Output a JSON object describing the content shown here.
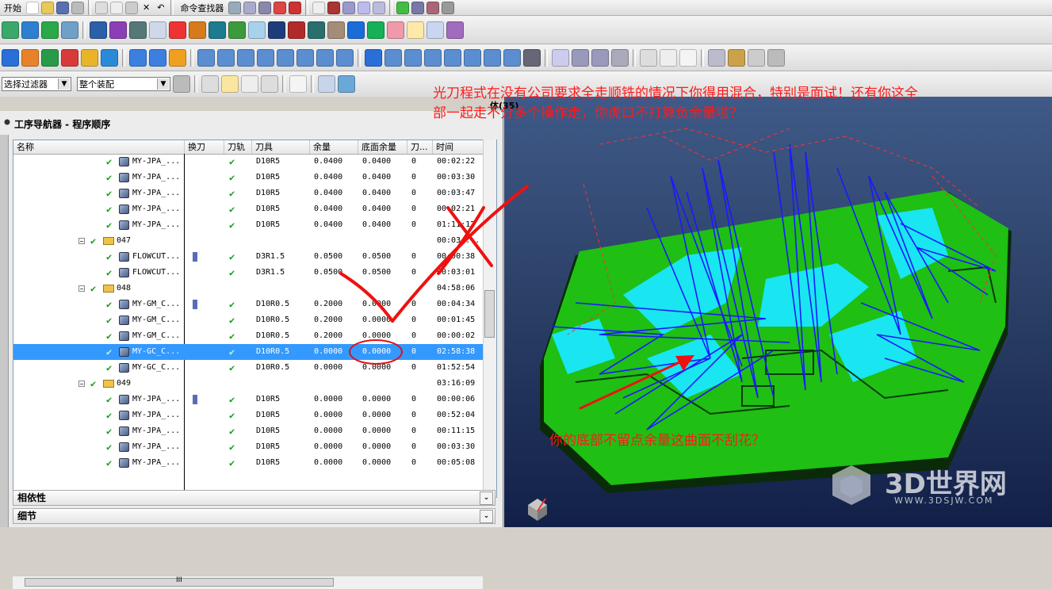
{
  "toolbar_row1": {
    "start_label": "开始",
    "command_finder_label": "命令查找器"
  },
  "toolbar_row4": {
    "filter_value": "选择过滤器",
    "assembly_value": "整个装配"
  },
  "navigator": {
    "title": "工序导航器 - 程序顺序",
    "columns": [
      "名称",
      "换刀",
      "刀轨",
      "刀具",
      "余量",
      "底面余量",
      "刀...",
      "时间",
      "/"
    ],
    "rows": [
      {
        "type": "op",
        "name": "MY-JPA_...",
        "change": false,
        "path": true,
        "tool": "D10R5",
        "stock": "0.0400",
        "floor": "0.0400",
        "tn": "0",
        "time": "00:02:22",
        "selected": false
      },
      {
        "type": "op",
        "name": "MY-JPA_...",
        "change": false,
        "path": true,
        "tool": "D10R5",
        "stock": "0.0400",
        "floor": "0.0400",
        "tn": "0",
        "time": "00:03:30",
        "selected": false
      },
      {
        "type": "op",
        "name": "MY-JPA_...",
        "change": false,
        "path": true,
        "tool": "D10R5",
        "stock": "0.0400",
        "floor": "0.0400",
        "tn": "0",
        "time": "00:03:47",
        "selected": false
      },
      {
        "type": "op",
        "name": "MY-JPA_...",
        "change": false,
        "path": true,
        "tool": "D10R5",
        "stock": "0.0400",
        "floor": "0.0400",
        "tn": "0",
        "time": "00:02:21",
        "selected": false
      },
      {
        "type": "op",
        "name": "MY-JPA_...",
        "change": false,
        "path": true,
        "tool": "D10R5",
        "stock": "0.0400",
        "floor": "0.0400",
        "tn": "0",
        "time": "01:11:12",
        "selected": false
      },
      {
        "type": "group",
        "name": "047",
        "time": "00:03:..."
      },
      {
        "type": "op",
        "name": "FLOWCUT...",
        "change": true,
        "path": true,
        "tool": "D3R1.5",
        "stock": "0.0500",
        "floor": "0.0500",
        "tn": "0",
        "time": "00:00:38",
        "selected": false
      },
      {
        "type": "op",
        "name": "FLOWCUT...",
        "change": false,
        "path": true,
        "tool": "D3R1.5",
        "stock": "0.0500",
        "floor": "0.0500",
        "tn": "0",
        "time": "00:03:01",
        "selected": false
      },
      {
        "type": "group",
        "name": "048",
        "time": "04:58:06"
      },
      {
        "type": "op",
        "name": "MY-GM_C...",
        "change": true,
        "path": true,
        "tool": "D10R0.5",
        "stock": "0.2000",
        "floor": "0.0000",
        "tn": "0",
        "time": "00:04:34",
        "selected": false
      },
      {
        "type": "op",
        "name": "MY-GM_C...",
        "change": false,
        "path": true,
        "tool": "D10R0.5",
        "stock": "0.2000",
        "floor": "0.0000",
        "tn": "0",
        "time": "00:01:45",
        "selected": false
      },
      {
        "type": "op",
        "name": "MY-GM_C...",
        "change": false,
        "path": true,
        "tool": "D10R0.5",
        "stock": "0.2000",
        "floor": "0.0000",
        "tn": "0",
        "time": "00:00:02",
        "selected": false
      },
      {
        "type": "op",
        "name": "MY-GC_C...",
        "change": false,
        "path": true,
        "tool": "D10R0.5",
        "stock": "0.0000",
        "floor": "0.0000",
        "tn": "0",
        "time": "02:58:38",
        "selected": true
      },
      {
        "type": "op",
        "name": "MY-GC_C...",
        "change": false,
        "path": true,
        "tool": "D10R0.5",
        "stock": "0.0000",
        "floor": "0.0000",
        "tn": "0",
        "time": "01:52:54",
        "selected": false
      },
      {
        "type": "group",
        "name": "049",
        "time": "03:16:09"
      },
      {
        "type": "op",
        "name": "MY-JPA_...",
        "change": true,
        "path": true,
        "tool": "D10R5",
        "stock": "0.0000",
        "floor": "0.0000",
        "tn": "0",
        "time": "00:00:06",
        "selected": false
      },
      {
        "type": "op",
        "name": "MY-JPA_...",
        "change": false,
        "path": true,
        "tool": "D10R5",
        "stock": "0.0000",
        "floor": "0.0000",
        "tn": "0",
        "time": "00:52:04",
        "selected": false
      },
      {
        "type": "op",
        "name": "MY-JPA_...",
        "change": false,
        "path": true,
        "tool": "D10R5",
        "stock": "0.0000",
        "floor": "0.0000",
        "tn": "0",
        "time": "00:11:15",
        "selected": false
      },
      {
        "type": "op",
        "name": "MY-JPA_...",
        "change": false,
        "path": true,
        "tool": "D10R5",
        "stock": "0.0000",
        "floor": "0.0000",
        "tn": "0",
        "time": "00:03:30",
        "selected": false
      },
      {
        "type": "op",
        "name": "MY-JPA_...",
        "change": false,
        "path": true,
        "tool": "D10R5",
        "stock": "0.0000",
        "floor": "0.0000",
        "tn": "0",
        "time": "00:05:08",
        "selected": false
      }
    ],
    "hscroll_glyph": "III",
    "panels": [
      "相依性",
      "细节"
    ]
  },
  "viewport": {
    "label": "体(35)"
  },
  "annotations": {
    "top_line1": "光刀程式在没有公司要求全走顺铣的情况下你得用混合，特别是面试！还有你这全",
    "top_line2": "部一起走不分多个操作走，你虎口不打算负余量啦？",
    "bottom": "你的底部不留点余量这曲面不刮花？"
  },
  "watermark": {
    "name": "3D世界网",
    "url": "WWW.3DSJW.COM"
  },
  "colors": {
    "selection": "#3399ff",
    "annotation": "#ff1a1a",
    "check": "#1a9a1a",
    "model_green": "#1fbf14",
    "model_cyan": "#19e6f0",
    "toolpath_blue": "#1a1aff"
  }
}
